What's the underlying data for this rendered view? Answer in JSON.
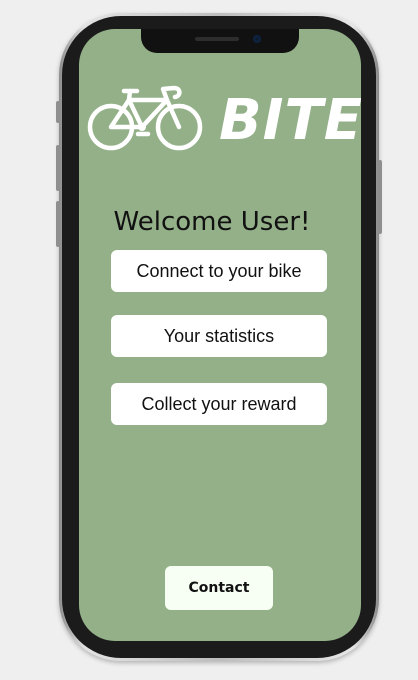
{
  "app": {
    "logo_text": "BITE",
    "logo_icon": "bicycle-icon",
    "welcome_text": "Welcome User!"
  },
  "menu": {
    "items": [
      {
        "label": "Connect to your bike"
      },
      {
        "label": "Your statistics"
      },
      {
        "label": "Collect your reward"
      }
    ]
  },
  "footer": {
    "contact_label": "Contact"
  },
  "colors": {
    "screen_background": "#93b088",
    "button_background": "#ffffff",
    "contact_background": "#f7fff4",
    "logo_color": "#ffffff",
    "page_background": "#efefef"
  }
}
